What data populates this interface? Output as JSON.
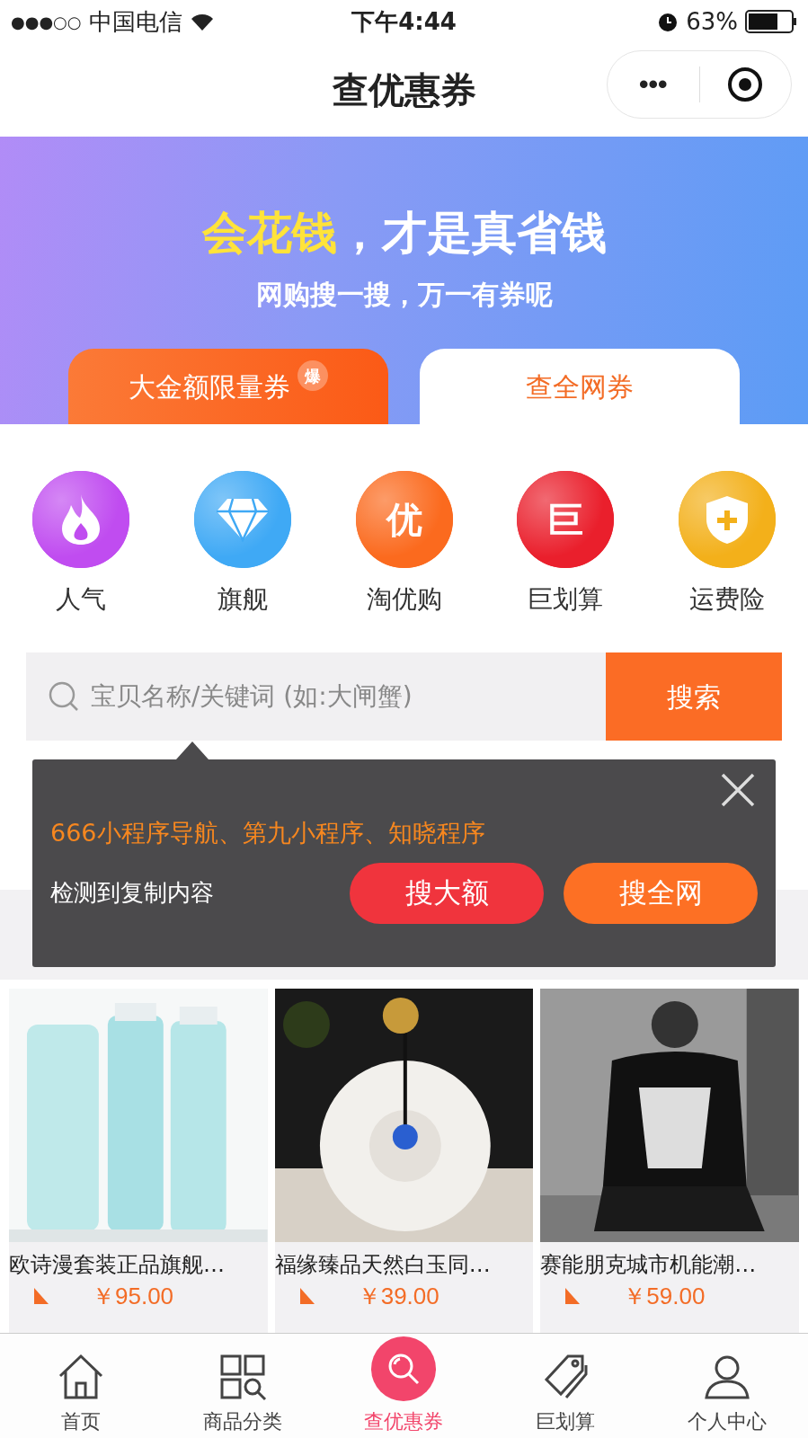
{
  "status_bar": {
    "signal": "●●●○○",
    "carrier": "中国电信",
    "time": "下午4:44",
    "battery": "63%"
  },
  "nav": {
    "title": "查优惠券",
    "more": "•••"
  },
  "banner": {
    "headline_highlight": "会花钱",
    "headline_rest": "，才是真省钱",
    "subtitle": "网购搜一搜，万一有券呢"
  },
  "tabs": [
    {
      "label": "大金额限量券",
      "badge": "爆",
      "selected": false
    },
    {
      "label": "查全网券",
      "selected": true
    }
  ],
  "shortcuts": [
    {
      "label": "人气",
      "kind": "fire",
      "color": "#c04cf0"
    },
    {
      "label": "旗舰",
      "kind": "diamond",
      "color": "#3fa9f5"
    },
    {
      "label": "淘优购",
      "kind": "glyph",
      "glyph": "优",
      "color": "#fb6a1e"
    },
    {
      "label": "巨划算",
      "kind": "glyph",
      "glyph": "巨",
      "color": "#ea1f2c"
    },
    {
      "label": "运费险",
      "kind": "shield",
      "color": "#f3b01a"
    }
  ],
  "search": {
    "placeholder": "宝贝名称/关键词 (如:大闸蟹)",
    "button": "搜索"
  },
  "popup": {
    "copied_text": "666小程序导航、第九小程序、知晓程序",
    "message": "检测到复制内容",
    "buttons": [
      {
        "label": "搜大额",
        "color": "#f0343d"
      },
      {
        "label": "搜全网",
        "color": "#fd7024"
      }
    ]
  },
  "products": [
    {
      "title": "欧诗漫套装正品旗舰…",
      "price": "￥95.00"
    },
    {
      "title": "福缘臻品天然白玉同…",
      "price": "￥39.00"
    },
    {
      "title": "赛能朋克城市机能潮…",
      "price": "￥59.00"
    }
  ],
  "tab_bar": [
    {
      "label": "首页",
      "kind": "home",
      "selected": false
    },
    {
      "label": "商品分类",
      "kind": "grid",
      "selected": false
    },
    {
      "label": "查优惠券",
      "kind": "search",
      "selected": true
    },
    {
      "label": "巨划算",
      "kind": "tag",
      "selected": false
    },
    {
      "label": "个人中心",
      "kind": "person",
      "selected": false
    }
  ]
}
